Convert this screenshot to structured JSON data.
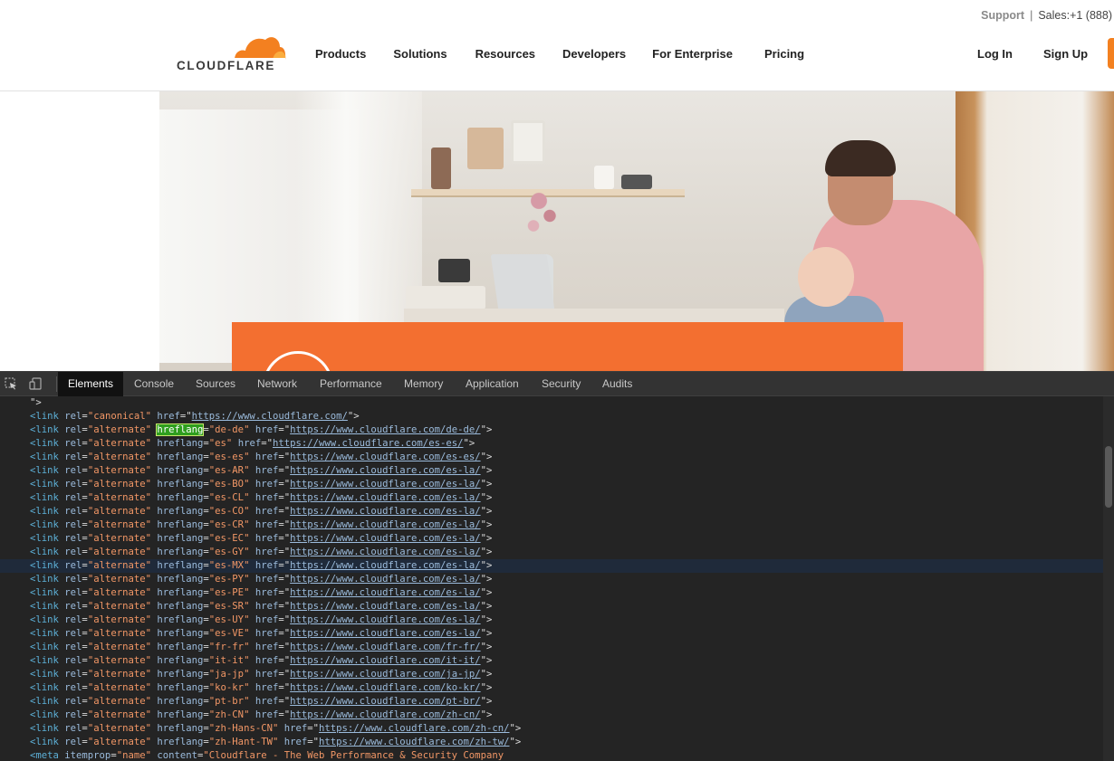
{
  "utility_bar": {
    "support": "Support",
    "separator": "|",
    "sales": "Sales:+1 (888)"
  },
  "brand": {
    "logo_text": "CLOUDFLARE",
    "accent": "#f38020",
    "accent_light": "#faad3f"
  },
  "nav": {
    "items": [
      "Products",
      "Solutions",
      "Resources",
      "Developers",
      "For Enterprise",
      "Pricing"
    ],
    "login": "Log In",
    "signup": "Sign Up"
  },
  "hero": {
    "promo_color": "#f36f30"
  },
  "devtools": {
    "tabs": [
      "Elements",
      "Console",
      "Sources",
      "Network",
      "Performance",
      "Memory",
      "Application",
      "Security",
      "Audits"
    ],
    "active_tab": "Elements",
    "highlighted_line": 12,
    "lines": [
      [
        [
          "p",
          "\">"
        ]
      ],
      [
        [
          "t",
          "<link "
        ],
        [
          "a",
          "rel"
        ],
        [
          "p",
          "="
        ],
        [
          "v",
          "\"canonical\""
        ],
        [
          "p",
          " "
        ],
        [
          "a",
          "href"
        ],
        [
          "p",
          "=\""
        ],
        [
          "l",
          "https://www.cloudflare.com/"
        ],
        [
          "p",
          "\">"
        ]
      ],
      [
        [
          "t",
          "<link "
        ],
        [
          "a",
          "rel"
        ],
        [
          "p",
          "="
        ],
        [
          "v",
          "\"alternate\""
        ],
        [
          "p",
          " "
        ],
        [
          "h",
          "hreflang"
        ],
        [
          "p",
          "="
        ],
        [
          "v",
          "\"de-de\""
        ],
        [
          "p",
          " "
        ],
        [
          "a",
          "href"
        ],
        [
          "p",
          "=\""
        ],
        [
          "l",
          "https://www.cloudflare.com/de-de/"
        ],
        [
          "p",
          "\">"
        ]
      ],
      [
        [
          "t",
          "<link "
        ],
        [
          "a",
          "rel"
        ],
        [
          "p",
          "="
        ],
        [
          "v",
          "\"alternate\""
        ],
        [
          "p",
          " "
        ],
        [
          "a",
          "hreflang"
        ],
        [
          "p",
          "="
        ],
        [
          "v",
          "\"es\""
        ],
        [
          "p",
          " "
        ],
        [
          "a",
          "href"
        ],
        [
          "p",
          "=\""
        ],
        [
          "l",
          "https://www.cloudflare.com/es-es/"
        ],
        [
          "p",
          "\">"
        ]
      ],
      [
        [
          "t",
          "<link "
        ],
        [
          "a",
          "rel"
        ],
        [
          "p",
          "="
        ],
        [
          "v",
          "\"alternate\""
        ],
        [
          "p",
          " "
        ],
        [
          "a",
          "hreflang"
        ],
        [
          "p",
          "="
        ],
        [
          "v",
          "\"es-es\""
        ],
        [
          "p",
          " "
        ],
        [
          "a",
          "href"
        ],
        [
          "p",
          "=\""
        ],
        [
          "l",
          "https://www.cloudflare.com/es-es/"
        ],
        [
          "p",
          "\">"
        ]
      ],
      [
        [
          "t",
          "<link "
        ],
        [
          "a",
          "rel"
        ],
        [
          "p",
          "="
        ],
        [
          "v",
          "\"alternate\""
        ],
        [
          "p",
          " "
        ],
        [
          "a",
          "hreflang"
        ],
        [
          "p",
          "="
        ],
        [
          "v",
          "\"es-AR\""
        ],
        [
          "p",
          " "
        ],
        [
          "a",
          "href"
        ],
        [
          "p",
          "=\""
        ],
        [
          "l",
          "https://www.cloudflare.com/es-la/"
        ],
        [
          "p",
          "\">"
        ]
      ],
      [
        [
          "t",
          "<link "
        ],
        [
          "a",
          "rel"
        ],
        [
          "p",
          "="
        ],
        [
          "v",
          "\"alternate\""
        ],
        [
          "p",
          " "
        ],
        [
          "a",
          "hreflang"
        ],
        [
          "p",
          "="
        ],
        [
          "v",
          "\"es-BO\""
        ],
        [
          "p",
          " "
        ],
        [
          "a",
          "href"
        ],
        [
          "p",
          "=\""
        ],
        [
          "l",
          "https://www.cloudflare.com/es-la/"
        ],
        [
          "p",
          "\">"
        ]
      ],
      [
        [
          "t",
          "<link "
        ],
        [
          "a",
          "rel"
        ],
        [
          "p",
          "="
        ],
        [
          "v",
          "\"alternate\""
        ],
        [
          "p",
          " "
        ],
        [
          "a",
          "hreflang"
        ],
        [
          "p",
          "="
        ],
        [
          "v",
          "\"es-CL\""
        ],
        [
          "p",
          " "
        ],
        [
          "a",
          "href"
        ],
        [
          "p",
          "=\""
        ],
        [
          "l",
          "https://www.cloudflare.com/es-la/"
        ],
        [
          "p",
          "\">"
        ]
      ],
      [
        [
          "t",
          "<link "
        ],
        [
          "a",
          "rel"
        ],
        [
          "p",
          "="
        ],
        [
          "v",
          "\"alternate\""
        ],
        [
          "p",
          " "
        ],
        [
          "a",
          "hreflang"
        ],
        [
          "p",
          "="
        ],
        [
          "v",
          "\"es-CO\""
        ],
        [
          "p",
          " "
        ],
        [
          "a",
          "href"
        ],
        [
          "p",
          "=\""
        ],
        [
          "l",
          "https://www.cloudflare.com/es-la/"
        ],
        [
          "p",
          "\">"
        ]
      ],
      [
        [
          "t",
          "<link "
        ],
        [
          "a",
          "rel"
        ],
        [
          "p",
          "="
        ],
        [
          "v",
          "\"alternate\""
        ],
        [
          "p",
          " "
        ],
        [
          "a",
          "hreflang"
        ],
        [
          "p",
          "="
        ],
        [
          "v",
          "\"es-CR\""
        ],
        [
          "p",
          " "
        ],
        [
          "a",
          "href"
        ],
        [
          "p",
          "=\""
        ],
        [
          "l",
          "https://www.cloudflare.com/es-la/"
        ],
        [
          "p",
          "\">"
        ]
      ],
      [
        [
          "t",
          "<link "
        ],
        [
          "a",
          "rel"
        ],
        [
          "p",
          "="
        ],
        [
          "v",
          "\"alternate\""
        ],
        [
          "p",
          " "
        ],
        [
          "a",
          "hreflang"
        ],
        [
          "p",
          "="
        ],
        [
          "v",
          "\"es-EC\""
        ],
        [
          "p",
          " "
        ],
        [
          "a",
          "href"
        ],
        [
          "p",
          "=\""
        ],
        [
          "l",
          "https://www.cloudflare.com/es-la/"
        ],
        [
          "p",
          "\">"
        ]
      ],
      [
        [
          "t",
          "<link "
        ],
        [
          "a",
          "rel"
        ],
        [
          "p",
          "="
        ],
        [
          "v",
          "\"alternate\""
        ],
        [
          "p",
          " "
        ],
        [
          "a",
          "hreflang"
        ],
        [
          "p",
          "="
        ],
        [
          "v",
          "\"es-GY\""
        ],
        [
          "p",
          " "
        ],
        [
          "a",
          "href"
        ],
        [
          "p",
          "=\""
        ],
        [
          "l",
          "https://www.cloudflare.com/es-la/"
        ],
        [
          "p",
          "\">"
        ]
      ],
      [
        [
          "t",
          "<link "
        ],
        [
          "a",
          "rel"
        ],
        [
          "p",
          "="
        ],
        [
          "v",
          "\"alternate\""
        ],
        [
          "p",
          " "
        ],
        [
          "a",
          "hreflang"
        ],
        [
          "p",
          "="
        ],
        [
          "v",
          "\"es-MX\""
        ],
        [
          "p",
          " "
        ],
        [
          "a",
          "href"
        ],
        [
          "p",
          "=\""
        ],
        [
          "l",
          "https://www.cloudflare.com/es-la/"
        ],
        [
          "p",
          "\">"
        ]
      ],
      [
        [
          "t",
          "<link "
        ],
        [
          "a",
          "rel"
        ],
        [
          "p",
          "="
        ],
        [
          "v",
          "\"alternate\""
        ],
        [
          "p",
          " "
        ],
        [
          "a",
          "hreflang"
        ],
        [
          "p",
          "="
        ],
        [
          "v",
          "\"es-PY\""
        ],
        [
          "p",
          " "
        ],
        [
          "a",
          "href"
        ],
        [
          "p",
          "=\""
        ],
        [
          "l",
          "https://www.cloudflare.com/es-la/"
        ],
        [
          "p",
          "\">"
        ]
      ],
      [
        [
          "t",
          "<link "
        ],
        [
          "a",
          "rel"
        ],
        [
          "p",
          "="
        ],
        [
          "v",
          "\"alternate\""
        ],
        [
          "p",
          " "
        ],
        [
          "a",
          "hreflang"
        ],
        [
          "p",
          "="
        ],
        [
          "v",
          "\"es-PE\""
        ],
        [
          "p",
          " "
        ],
        [
          "a",
          "href"
        ],
        [
          "p",
          "=\""
        ],
        [
          "l",
          "https://www.cloudflare.com/es-la/"
        ],
        [
          "p",
          "\">"
        ]
      ],
      [
        [
          "t",
          "<link "
        ],
        [
          "a",
          "rel"
        ],
        [
          "p",
          "="
        ],
        [
          "v",
          "\"alternate\""
        ],
        [
          "p",
          " "
        ],
        [
          "a",
          "hreflang"
        ],
        [
          "p",
          "="
        ],
        [
          "v",
          "\"es-SR\""
        ],
        [
          "p",
          " "
        ],
        [
          "a",
          "href"
        ],
        [
          "p",
          "=\""
        ],
        [
          "l",
          "https://www.cloudflare.com/es-la/"
        ],
        [
          "p",
          "\">"
        ]
      ],
      [
        [
          "t",
          "<link "
        ],
        [
          "a",
          "rel"
        ],
        [
          "p",
          "="
        ],
        [
          "v",
          "\"alternate\""
        ],
        [
          "p",
          " "
        ],
        [
          "a",
          "hreflang"
        ],
        [
          "p",
          "="
        ],
        [
          "v",
          "\"es-UY\""
        ],
        [
          "p",
          " "
        ],
        [
          "a",
          "href"
        ],
        [
          "p",
          "=\""
        ],
        [
          "l",
          "https://www.cloudflare.com/es-la/"
        ],
        [
          "p",
          "\">"
        ]
      ],
      [
        [
          "t",
          "<link "
        ],
        [
          "a",
          "rel"
        ],
        [
          "p",
          "="
        ],
        [
          "v",
          "\"alternate\""
        ],
        [
          "p",
          " "
        ],
        [
          "a",
          "hreflang"
        ],
        [
          "p",
          "="
        ],
        [
          "v",
          "\"es-VE\""
        ],
        [
          "p",
          " "
        ],
        [
          "a",
          "href"
        ],
        [
          "p",
          "=\""
        ],
        [
          "l",
          "https://www.cloudflare.com/es-la/"
        ],
        [
          "p",
          "\">"
        ]
      ],
      [
        [
          "t",
          "<link "
        ],
        [
          "a",
          "rel"
        ],
        [
          "p",
          "="
        ],
        [
          "v",
          "\"alternate\""
        ],
        [
          "p",
          " "
        ],
        [
          "a",
          "hreflang"
        ],
        [
          "p",
          "="
        ],
        [
          "v",
          "\"fr-fr\""
        ],
        [
          "p",
          " "
        ],
        [
          "a",
          "href"
        ],
        [
          "p",
          "=\""
        ],
        [
          "l",
          "https://www.cloudflare.com/fr-fr/"
        ],
        [
          "p",
          "\">"
        ]
      ],
      [
        [
          "t",
          "<link "
        ],
        [
          "a",
          "rel"
        ],
        [
          "p",
          "="
        ],
        [
          "v",
          "\"alternate\""
        ],
        [
          "p",
          " "
        ],
        [
          "a",
          "hreflang"
        ],
        [
          "p",
          "="
        ],
        [
          "v",
          "\"it-it\""
        ],
        [
          "p",
          " "
        ],
        [
          "a",
          "href"
        ],
        [
          "p",
          "=\""
        ],
        [
          "l",
          "https://www.cloudflare.com/it-it/"
        ],
        [
          "p",
          "\">"
        ]
      ],
      [
        [
          "t",
          "<link "
        ],
        [
          "a",
          "rel"
        ],
        [
          "p",
          "="
        ],
        [
          "v",
          "\"alternate\""
        ],
        [
          "p",
          " "
        ],
        [
          "a",
          "hreflang"
        ],
        [
          "p",
          "="
        ],
        [
          "v",
          "\"ja-jp\""
        ],
        [
          "p",
          " "
        ],
        [
          "a",
          "href"
        ],
        [
          "p",
          "=\""
        ],
        [
          "l",
          "https://www.cloudflare.com/ja-jp/"
        ],
        [
          "p",
          "\">"
        ]
      ],
      [
        [
          "t",
          "<link "
        ],
        [
          "a",
          "rel"
        ],
        [
          "p",
          "="
        ],
        [
          "v",
          "\"alternate\""
        ],
        [
          "p",
          " "
        ],
        [
          "a",
          "hreflang"
        ],
        [
          "p",
          "="
        ],
        [
          "v",
          "\"ko-kr\""
        ],
        [
          "p",
          " "
        ],
        [
          "a",
          "href"
        ],
        [
          "p",
          "=\""
        ],
        [
          "l",
          "https://www.cloudflare.com/ko-kr/"
        ],
        [
          "p",
          "\">"
        ]
      ],
      [
        [
          "t",
          "<link "
        ],
        [
          "a",
          "rel"
        ],
        [
          "p",
          "="
        ],
        [
          "v",
          "\"alternate\""
        ],
        [
          "p",
          " "
        ],
        [
          "a",
          "hreflang"
        ],
        [
          "p",
          "="
        ],
        [
          "v",
          "\"pt-br\""
        ],
        [
          "p",
          " "
        ],
        [
          "a",
          "href"
        ],
        [
          "p",
          "=\""
        ],
        [
          "l",
          "https://www.cloudflare.com/pt-br/"
        ],
        [
          "p",
          "\">"
        ]
      ],
      [
        [
          "t",
          "<link "
        ],
        [
          "a",
          "rel"
        ],
        [
          "p",
          "="
        ],
        [
          "v",
          "\"alternate\""
        ],
        [
          "p",
          " "
        ],
        [
          "a",
          "hreflang"
        ],
        [
          "p",
          "="
        ],
        [
          "v",
          "\"zh-CN\""
        ],
        [
          "p",
          " "
        ],
        [
          "a",
          "href"
        ],
        [
          "p",
          "=\""
        ],
        [
          "l",
          "https://www.cloudflare.com/zh-cn/"
        ],
        [
          "p",
          "\">"
        ]
      ],
      [
        [
          "t",
          "<link "
        ],
        [
          "a",
          "rel"
        ],
        [
          "p",
          "="
        ],
        [
          "v",
          "\"alternate\""
        ],
        [
          "p",
          " "
        ],
        [
          "a",
          "hreflang"
        ],
        [
          "p",
          "="
        ],
        [
          "v",
          "\"zh-Hans-CN\""
        ],
        [
          "p",
          " "
        ],
        [
          "a",
          "href"
        ],
        [
          "p",
          "=\""
        ],
        [
          "l",
          "https://www.cloudflare.com/zh-cn/"
        ],
        [
          "p",
          "\">"
        ]
      ],
      [
        [
          "t",
          "<link "
        ],
        [
          "a",
          "rel"
        ],
        [
          "p",
          "="
        ],
        [
          "v",
          "\"alternate\""
        ],
        [
          "p",
          " "
        ],
        [
          "a",
          "hreflang"
        ],
        [
          "p",
          "="
        ],
        [
          "v",
          "\"zh-Hant-TW\""
        ],
        [
          "p",
          " "
        ],
        [
          "a",
          "href"
        ],
        [
          "p",
          "=\""
        ],
        [
          "l",
          "https://www.cloudflare.com/zh-tw/"
        ],
        [
          "p",
          "\">"
        ]
      ],
      [
        [
          "t",
          "<meta "
        ],
        [
          "a",
          "itemprop"
        ],
        [
          "p",
          "="
        ],
        [
          "v",
          "\"name\""
        ],
        [
          "p",
          " "
        ],
        [
          "a",
          "content"
        ],
        [
          "p",
          "="
        ],
        [
          "v",
          "\"Cloudflare - The Web Performance & Security Company"
        ]
      ]
    ]
  }
}
